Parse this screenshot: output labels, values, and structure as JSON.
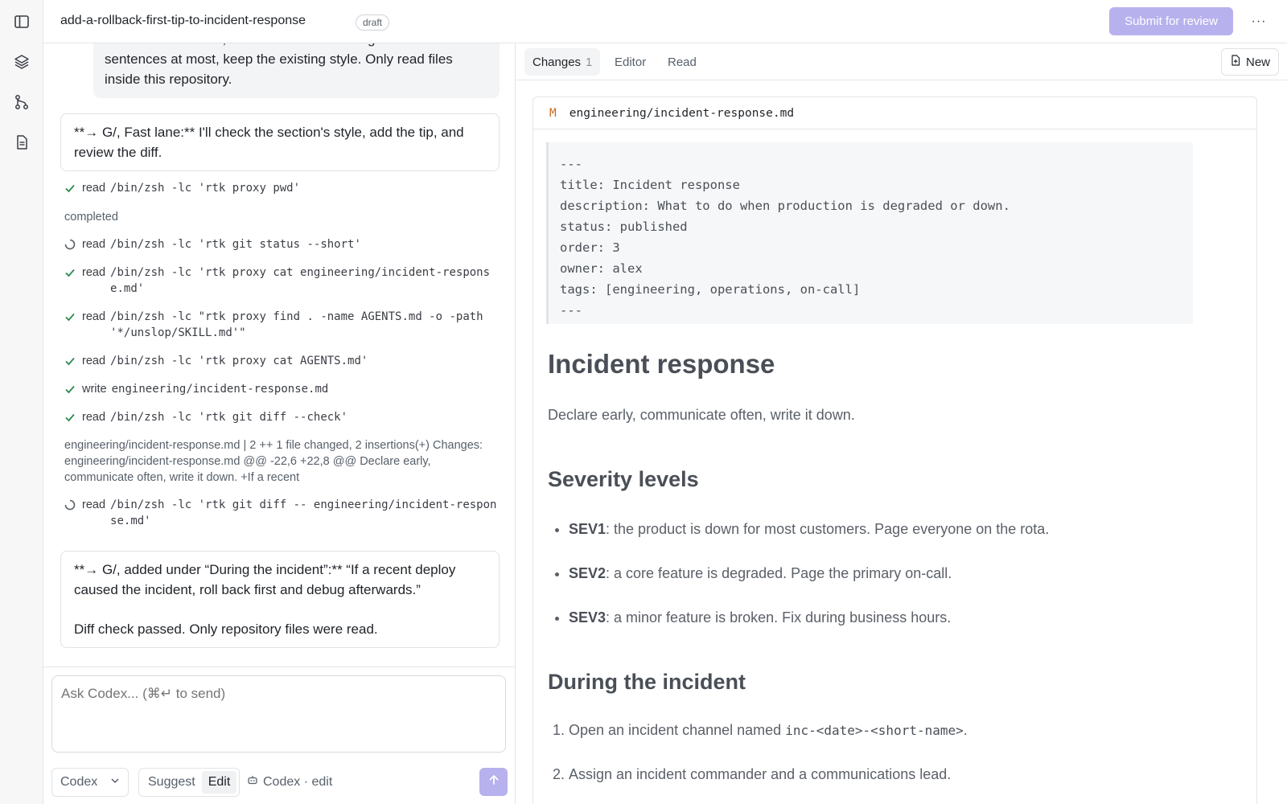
{
  "rail": {
    "icons": [
      "sidebar-toggle-icon",
      "layers-icon",
      "git-branch-icon",
      "document-icon"
    ]
  },
  "topbar": {
    "title": "add-a-rollback-first-tip-to-incident-response",
    "badge": "draft",
    "submit_label": "Submit for review",
    "more_label": "···"
  },
  "chat": {
    "user_message": "caused the incident, roll back first and debug afterwards.\" Two sentences at most, keep the existing style. Only read files inside this repository.",
    "reply1": "**→ G/, Fast lane:** I'll check the section's style, add the tip, and review the diff.",
    "tools": [
      {
        "status": "done",
        "verb": "read",
        "cmd": "/bin/zsh -lc 'rtk proxy pwd'"
      },
      {
        "status": "note",
        "text": "completed"
      },
      {
        "status": "running",
        "verb": "read",
        "cmd": "/bin/zsh -lc 'rtk git status --short'"
      },
      {
        "status": "done",
        "verb": "read",
        "cmd": "/bin/zsh -lc 'rtk proxy cat engineering/incident-response.md'"
      },
      {
        "status": "done",
        "verb": "read",
        "cmd": "/bin/zsh -lc \"rtk proxy find . -name AGENTS.md -o -path '*/unslop/SKILL.md'\""
      },
      {
        "status": "done",
        "verb": "read",
        "cmd": "/bin/zsh -lc 'rtk proxy cat AGENTS.md'"
      },
      {
        "status": "done",
        "verb": "write",
        "cmd": "engineering/incident-response.md"
      },
      {
        "status": "done",
        "verb": "read",
        "cmd": "/bin/zsh -lc 'rtk git diff --check'"
      },
      {
        "status": "note",
        "text": "engineering/incident-response.md | 2 ++ 1 file changed, 2 insertions(+) Changes: engineering/incident-response.md @@ -22,6 +22,8 @@ Declare early, communicate often, write it down. +If a recent"
      },
      {
        "status": "running",
        "verb": "read",
        "cmd": "/bin/zsh -lc 'rtk git diff -- engineering/incident-response.md'"
      }
    ],
    "reply2_line1": "**→ G/, added under “During the incident”:** “If a recent deploy caused the incident, roll back first and debug afterwards.”",
    "reply2_line2": "Diff check passed. Only repository files were read."
  },
  "composer": {
    "placeholder": "Ask Codex... (⌘↵ to send)",
    "model": "Codex",
    "modes": [
      "Suggest",
      "Edit"
    ],
    "active_mode": "Edit",
    "status": "Codex · edit"
  },
  "right": {
    "tabs": [
      {
        "label": "Changes",
        "count": "1"
      },
      {
        "label": "Editor",
        "count": ""
      },
      {
        "label": "Read",
        "count": ""
      }
    ],
    "new_label": "New",
    "file": {
      "status": "M",
      "path": "engineering/incident-response.md"
    },
    "frontmatter": [
      "---",
      "title: Incident response",
      "description: What to do when production is degraded or down.",
      "status: published",
      "order: 3",
      "owner: alex",
      "tags: [engineering, operations, on-call]",
      "---"
    ],
    "doc": {
      "h1": "Incident response",
      "lead": "Declare early, communicate often, write it down.",
      "h2_severity": "Severity levels",
      "severity": [
        {
          "key": "SEV1",
          "text": ": the product is down for most customers. Page everyone on the rota."
        },
        {
          "key": "SEV2",
          "text": ": a core feature is degraded. Page the primary on-call."
        },
        {
          "key": "SEV3",
          "text": ": a minor feature is broken. Fix during business hours."
        }
      ],
      "h2_during": "During the incident",
      "steps_1_prefix": "Open an incident channel named ",
      "steps_1_code": "inc-<date>-<short-name>",
      "steps_1_suffix": ".",
      "steps_2": "Assign an incident commander and a communications lead."
    }
  }
}
